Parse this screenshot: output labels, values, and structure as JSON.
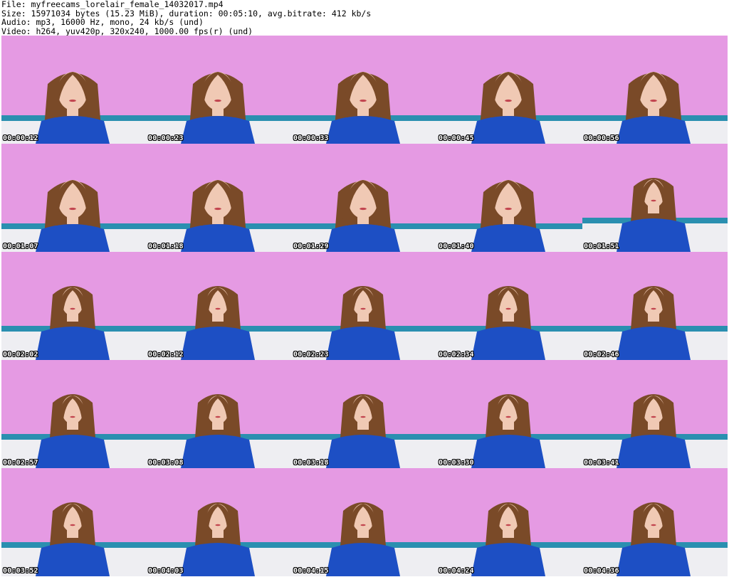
{
  "header": {
    "file_line": "File: myfreecams_lorelair_female_14032017.mp4",
    "size_line": "Size: 15971034 bytes (15.23 MiB), duration: 00:05:10, avg.bitrate: 412 kb/s",
    "audio_line": "Audio: mp3, 16000 Hz, mono, 24 kb/s (und)",
    "video_line": "Video: h264, yuv420p, 320x240, 1000.00 fps(r) (und)"
  },
  "colors": {
    "wall_pink": "#e59ae3",
    "shirt_blue": "#1d4fc4",
    "bed_white": "#eeeef2",
    "hair_brown": "#7a4a28",
    "skin": "#f0c9b4",
    "teal_stripe": "#2a8fb0"
  },
  "thumbnails": [
    {
      "timestamp": "00:00:12"
    },
    {
      "timestamp": "00:00:23"
    },
    {
      "timestamp": "00:00:33"
    },
    {
      "timestamp": "00:00:45"
    },
    {
      "timestamp": "00:00:56"
    },
    {
      "timestamp": "00:01:07"
    },
    {
      "timestamp": "00:01:18"
    },
    {
      "timestamp": "00:01:29"
    },
    {
      "timestamp": "00:01:40"
    },
    {
      "timestamp": "00:01:51"
    },
    {
      "timestamp": "00:02:02"
    },
    {
      "timestamp": "00:02:12"
    },
    {
      "timestamp": "00:02:23"
    },
    {
      "timestamp": "00:02:34"
    },
    {
      "timestamp": "00:02:46"
    },
    {
      "timestamp": "00:02:57"
    },
    {
      "timestamp": "00:03:08"
    },
    {
      "timestamp": "00:03:18"
    },
    {
      "timestamp": "00:03:30"
    },
    {
      "timestamp": "00:03:41"
    },
    {
      "timestamp": "00:03:52"
    },
    {
      "timestamp": "00:04:03"
    },
    {
      "timestamp": "00:04:15"
    },
    {
      "timestamp": "00:04:24"
    },
    {
      "timestamp": "00:04:36"
    }
  ]
}
